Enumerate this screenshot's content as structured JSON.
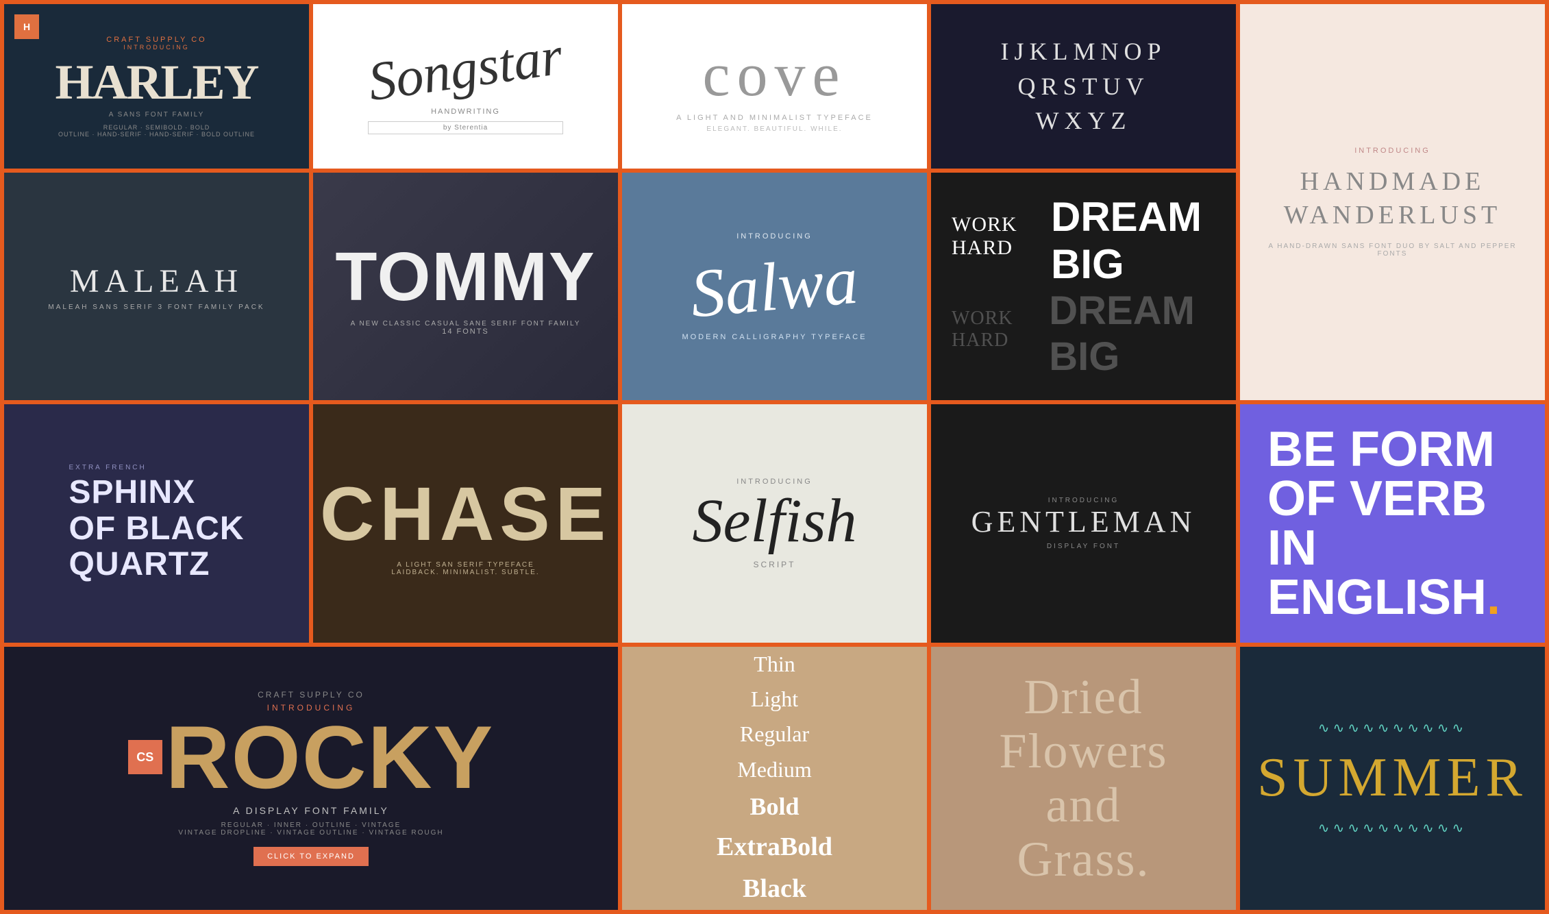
{
  "grid": {
    "cells": [
      {
        "id": "harley",
        "badge": "H",
        "intro": "CRAFT SUPPLY CO",
        "introducing": "INTRODUCING",
        "title": "HARLEY",
        "subtitle": "A SANS FONT FAMILY",
        "tagline": "REGULAR · SEMIBOLD · BOLD",
        "styles": "OUTLINE · HAND-SERIF · HAND-SERIF · BOLD OUTLINE"
      },
      {
        "id": "songstar",
        "title": "Songstar",
        "handwriting": "HANDWRITING",
        "by": "by Sterentia"
      },
      {
        "id": "cove",
        "title": "cove",
        "subtitle": "A LIGHT AND MINIMALIST TYPEFACE",
        "desc": "ELEGANT. BEAUTIFUL. WHILE."
      },
      {
        "id": "ijkl",
        "text": "IJKLMNOP\nQRSTUV\nWXYZ"
      },
      {
        "id": "handmade",
        "intro": "INTRODUCING",
        "title": "HANDMADE\nWANDERLUST",
        "desc": "A HAND-DRAWN SANS FONT DUO\nBY SALT AND PEPPER FONTS"
      },
      {
        "id": "maleah",
        "title": "MALEAH",
        "sub": "MALEAH SANS SERIF 3 FONT FAMILY PACK"
      },
      {
        "id": "tommy",
        "title": "TOMMY",
        "sub": "A NEW CLASSIC CASUAL SANE SERIF FONT FAMILY",
        "count": "14 FONTS"
      },
      {
        "id": "salwa",
        "intro": "INTRODUCING",
        "title": "Salwa",
        "sub": "MODERN CALLIGRAPHY TYPEFACE"
      },
      {
        "id": "workhard",
        "line1": "WORK HARD",
        "big1": "DREAM BIG",
        "line2": "WORK HARD",
        "big2": "DREAM BIG"
      },
      {
        "id": "sphinx",
        "sub": "EXTRA FRENCH",
        "title": "SPHINX\nOF BLACK\nQUARTZ"
      },
      {
        "id": "chase",
        "title": "CHASE",
        "sub": "A LIGHT SAN SERIF TYPEFACE\nLAIDBACK. MINIMALIST. SUBTLE."
      },
      {
        "id": "selfish",
        "intro": "INTRODUCING",
        "title": "Selfish",
        "type": "SCRIPT"
      },
      {
        "id": "gentleman",
        "intro": "INTRODUCING",
        "title": "GENTLEMAN",
        "sub": "DISPLAY FONT"
      },
      {
        "id": "beform",
        "line1": "BE FORM",
        "line2": "OF VERB IN",
        "line3": "ENGLISH",
        "dot": "."
      },
      {
        "id": "rocky",
        "craft": "CRAFT SUPPLY CO",
        "intro": "INTRODUCING",
        "badge": "CS",
        "title": "ROCKY",
        "sub": "A DISPLAY FONT FAMILY",
        "styles": "REGULAR · INNER · OUTLINE · VINTAGE\nVINTAGE DROPLINE · VINTAGE OUTLINE · VINTAGE ROUGH",
        "btn": "CLICK TO EXPAND"
      },
      {
        "id": "thin",
        "weights": [
          "Thin",
          "Light",
          "Regular",
          "Medium",
          "Bold",
          "ExtraBold",
          "Black"
        ]
      },
      {
        "id": "dried",
        "title": "Dried\nFlowers\nand\nGrass."
      },
      {
        "id": "summer",
        "deco1": "∿∿∿∿∿∿∿∿∿∿",
        "title": "SUMMER",
        "deco2": "∿∿∿∿∿∿∿∿∿∿"
      }
    ]
  }
}
